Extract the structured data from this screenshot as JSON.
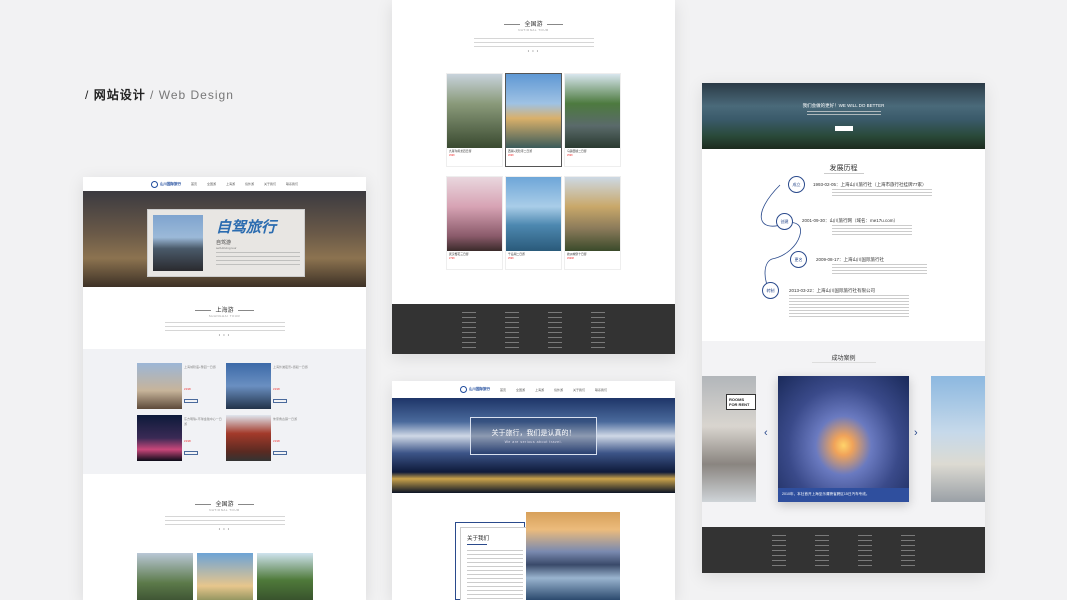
{
  "heading": {
    "cn": "网站设计",
    "sep": "/",
    "en": "Web Design"
  },
  "left": {
    "logo": "山川国际旅行",
    "nav": [
      "首页",
      "全国游",
      "上海游",
      "境外游",
      "关于我们",
      "联系我们"
    ],
    "banner": {
      "title": "自驾旅行",
      "sub": "自驾游",
      "en": "self-driving tour"
    },
    "shanghai": {
      "title": "上海游",
      "sub": "SHANGHAI TOUR",
      "dots": "• • •"
    },
    "shanghai_items": [
      {
        "cap": "上海城隍庙+豫园一日游",
        "price": "¥198"
      },
      {
        "cap": "上海外滩夜景+游船一日游",
        "price": "¥198"
      },
      {
        "cap": "东方明珠+环球金融中心一日游",
        "price": "¥198"
      },
      {
        "cap": "朱家角古镇一日游",
        "price": "¥198"
      }
    ],
    "national": {
      "title": "全国游",
      "sub": "NATIONAL TOUR",
      "dots": "• • •"
    }
  },
  "mid_top": {
    "national": {
      "title": "全国游",
      "sub": "NATIONAL TOUR",
      "dots": "• • •"
    },
    "cards": [
      {
        "cap": "九寨沟黄龙四日游",
        "price": "¥998"
      },
      {
        "cap": "西湖+灵隐寺二日游",
        "price": "¥698"
      },
      {
        "cap": "乌镇西塘二日游",
        "price": "¥598"
      },
      {
        "cap": "武汉樱花三日游",
        "price": "¥798"
      },
      {
        "cap": "千岛湖二日游",
        "price": "¥598"
      },
      {
        "cap": "欧洲城堡十日游",
        "price": "¥9998"
      }
    ]
  },
  "mid_bottom": {
    "logo": "山川国际旅行",
    "nav": [
      "首页",
      "全国游",
      "上海游",
      "境外游",
      "关于我们",
      "联系我们"
    ],
    "hero_cn": "关于旅行，我们是认真的！",
    "hero_en": "We are serious about travel.",
    "about_title": "关于我们"
  },
  "right": {
    "hero_text": "我们会做的更好！WE WILL DO BETTER",
    "history_title": "发展历程",
    "timeline": [
      {
        "node": "成立",
        "date": "1993-02-05：上海山川旅行社（上海市旅行社挂牌77家）"
      },
      {
        "node": "创建",
        "date": "2001-09-30：山川旅行网（域名：me17u.com）"
      },
      {
        "node": "更名",
        "date": "2009-08-17：上海山川国际旅行社"
      },
      {
        "node": "转制",
        "date": "2013-03-22：上海山川国际旅行社有限公司"
      }
    ],
    "cases_title": "成功案例",
    "case_caption": "2010年，本社首开上海至乐清跨省跨区15日汽车专线。",
    "rooms_text": "ROOMS FOR RENT"
  }
}
